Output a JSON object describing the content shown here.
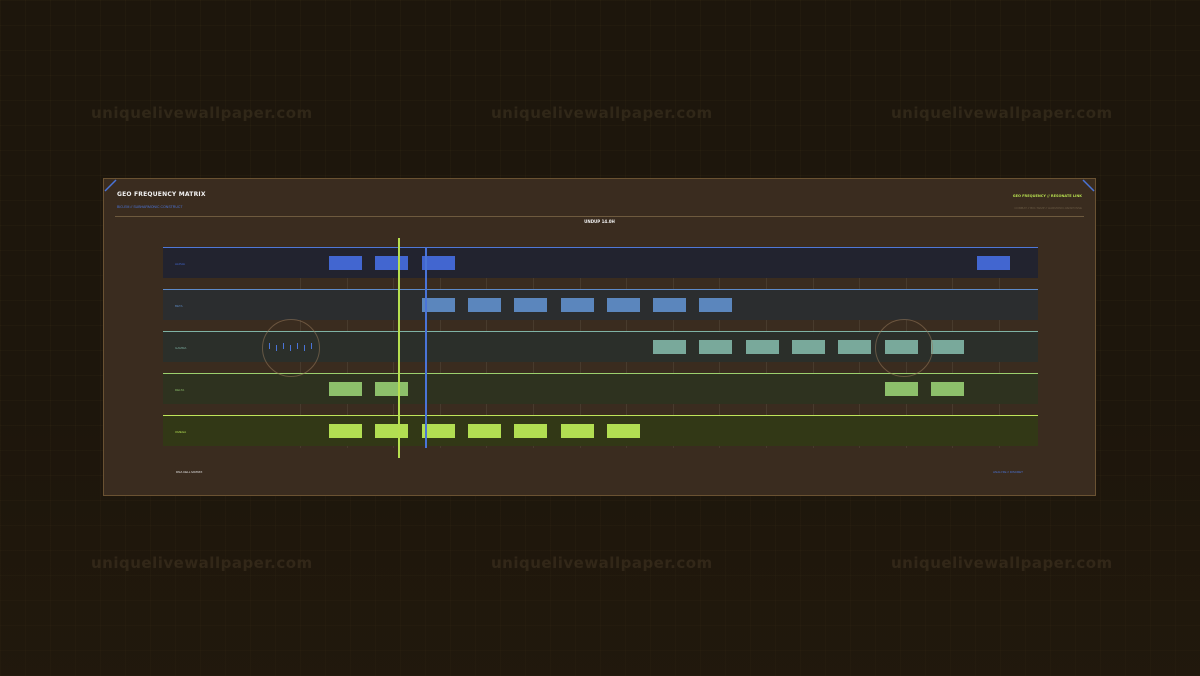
{
  "watermark": "uniquelivewallpaper.com",
  "header": {
    "title": "GEO FREQUENCY MATRIX",
    "subtitle": "BIO-EM // SUBHARMONIC CONSTRUCT",
    "right_title": "GEO FREQUENCY // RESONATE LINK",
    "right_subtitle": "COMBAT // BIO-TEMP // HARMONIC-RESPONSE"
  },
  "center_title": "UNDUP 14.0H",
  "tracks": [
    {
      "label": "ALPHA",
      "color": "#4266d0",
      "line": "#4f78d8",
      "bg": "#22232f",
      "cells": [
        4,
        5,
        6,
        18
      ]
    },
    {
      "label": "BETA",
      "color": "#5b86bd",
      "line": "#5d8ac8",
      "bg": "#2b2d2f",
      "cells": [
        6,
        7,
        8,
        9,
        10,
        11,
        12
      ]
    },
    {
      "label": "GAMMA",
      "color": "#79a99b",
      "line": "#7fb3a5",
      "bg": "#2b2f2a",
      "cells": [
        11,
        12,
        13,
        14,
        15,
        16,
        17
      ]
    },
    {
      "label": "DELTA",
      "color": "#8dbf6b",
      "line": "#9cd06e",
      "bg": "#2e321f",
      "cells": [
        4,
        5,
        16,
        17
      ]
    },
    {
      "label": "OMEGA",
      "color": "#b2de52",
      "line": "#bfe55a",
      "bg": "#323816",
      "cells": [
        4,
        5,
        6,
        7,
        8,
        9,
        10
      ]
    }
  ],
  "footer": {
    "left": "DNA CELL MATRIX",
    "right": "ANALYZE // DISCRET"
  },
  "colors": {
    "accent_green": "#b6df4f",
    "accent_blue": "#4a74d8",
    "panel": "#3a2c1f"
  }
}
